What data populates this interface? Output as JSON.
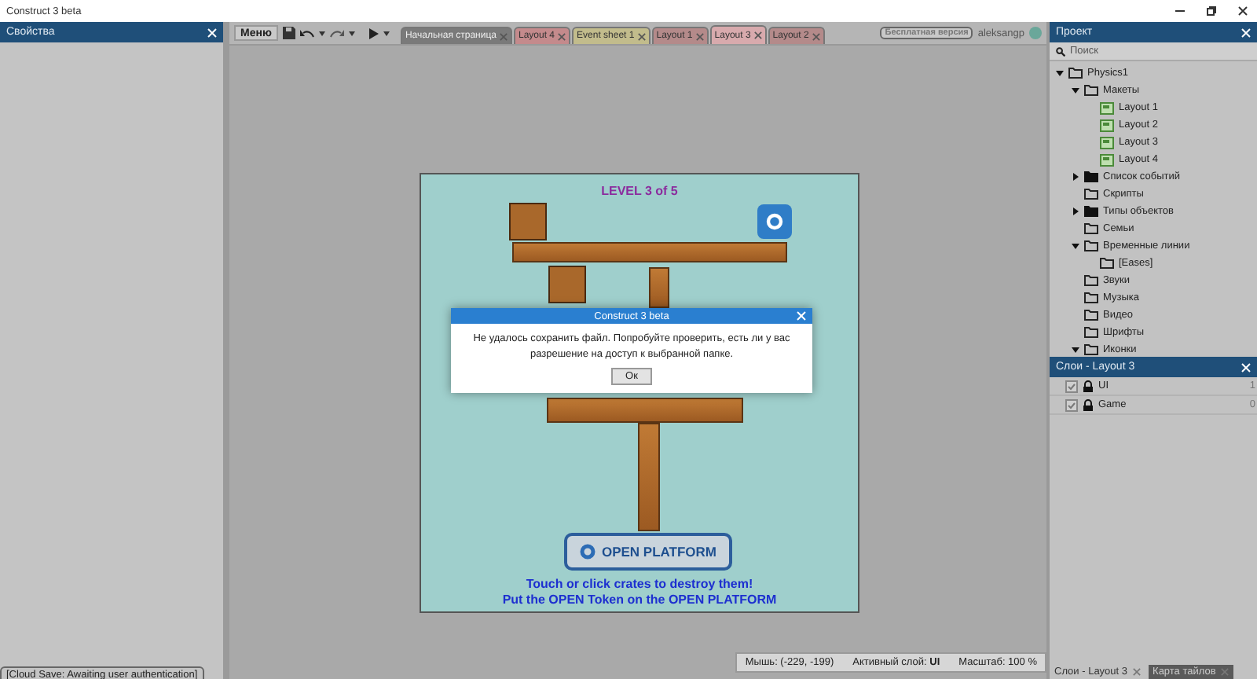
{
  "window": {
    "title": "Construct 3 beta"
  },
  "properties_panel": {
    "title": "Свойства"
  },
  "toolbar": {
    "menu_label": "Меню",
    "badge": "Бесплатная версия",
    "user": "aleksangp"
  },
  "tabs": [
    {
      "label": "Начальная страница",
      "selected": false,
      "color": "#7a7a7a"
    },
    {
      "label": "Layout 4",
      "selected": false,
      "color": "#c48a8c"
    },
    {
      "label": "Event sheet 1",
      "selected": false,
      "color": "#c2bc8c"
    },
    {
      "label": "Layout 1",
      "selected": false,
      "color": "#b48a8a"
    },
    {
      "label": "Layout 3",
      "selected": true,
      "color": "#d8aaad"
    },
    {
      "label": "Layout 2",
      "selected": false,
      "color": "#b48a8a"
    }
  ],
  "game": {
    "level_text": "LEVEL 3 of 5",
    "platform_button": "OPEN PLATFORM",
    "hint_lines": [
      "Touch or click crates to destroy them!",
      "Put the OPEN Token on the OPEN PLATFORM"
    ]
  },
  "status_bar": {
    "mouse": "Мышь: (-229, -199)",
    "active_layer": "Активный слой: **UI**",
    "zoom": "Масштаб: 100 %"
  },
  "cloud_save": "[Cloud Save: Awaiting user authentication]",
  "project_panel": {
    "title": "Проект",
    "search": {
      "placeholder": "Поиск"
    },
    "tree": [
      {
        "label": "Physics1",
        "kind": "folder",
        "expanded": true,
        "children": [
          {
            "label": "Макеты",
            "kind": "folder",
            "expanded": true,
            "children": [
              {
                "label": "Layout 1",
                "kind": "layout"
              },
              {
                "label": "Layout 2",
                "kind": "layout"
              },
              {
                "label": "Layout 3",
                "kind": "layout"
              },
              {
                "label": "Layout 4",
                "kind": "layout"
              }
            ]
          },
          {
            "label": "Список событий",
            "kind": "folder-filled",
            "expanded": false
          },
          {
            "label": "Скрипты",
            "kind": "folder"
          },
          {
            "label": "Типы объектов",
            "kind": "folder-filled",
            "expanded": false
          },
          {
            "label": "Семьи",
            "kind": "folder"
          },
          {
            "label": "Временные линии",
            "kind": "folder",
            "expanded": true,
            "children": [
              {
                "label": "[Eases]",
                "kind": "folder"
              }
            ]
          },
          {
            "label": "Звуки",
            "kind": "folder"
          },
          {
            "label": "Музыка",
            "kind": "folder"
          },
          {
            "label": "Видео",
            "kind": "folder"
          },
          {
            "label": "Шрифты",
            "kind": "folder"
          },
          {
            "label": "Иконки",
            "kind": "folder",
            "expanded": true
          }
        ]
      }
    ]
  },
  "layers_panel": {
    "title": "Слои - Layout 3",
    "layers": [
      {
        "name": "UI",
        "visible": true,
        "locked": true,
        "index": "1"
      },
      {
        "name": "Game",
        "visible": true,
        "locked": true,
        "index": "0"
      }
    ]
  },
  "bottom_tabs": [
    {
      "label": "Слои - Layout 3",
      "selected": true
    },
    {
      "label": "Карта тайлов",
      "selected": false
    }
  ],
  "dialog": {
    "title": "Construct 3 beta",
    "message": "Не удалось сохранить файл. Попробуйте проверить, есть ли у вас разрешение на доступ к выбранной папке.",
    "button": "Ок"
  }
}
